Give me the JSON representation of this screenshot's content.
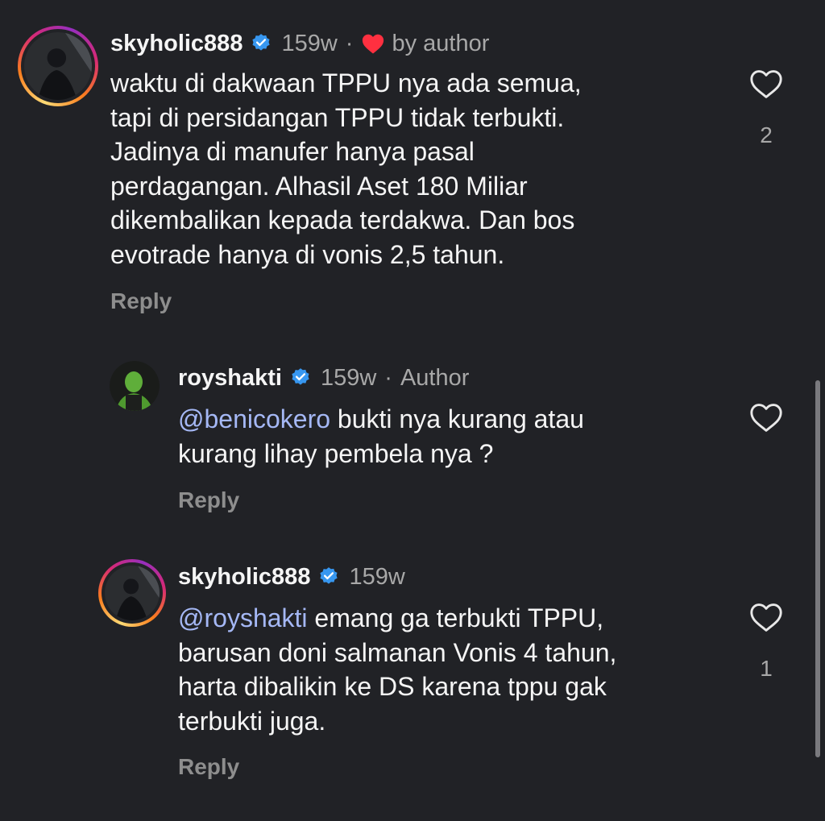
{
  "comments": [
    {
      "username": "skyholic888",
      "age": "159w",
      "separator": "·",
      "liked_label": "by author",
      "text_lines": [
        "waktu di dakwaan TPPU nya ada semua,",
        "tapi di persidangan TPPU tidak terbukti.",
        "Jadinya di manufer hanya pasal",
        "perdagangan. Alhasil Aset 180 Miliar",
        "dikembalikan kepada terdakwa. Dan bos",
        "evotrade hanya di vonis 2,5 tahun."
      ],
      "reply_label": "Reply",
      "like_count": "2"
    },
    {
      "username": "royshakti",
      "age": "159w",
      "separator": "·",
      "author_label": "Author",
      "mention": "@benicokero",
      "text_line1_rest": " bukti nya kurang atau",
      "text_line2": "kurang lihay  pembela  nya ?",
      "reply_label": "Reply"
    },
    {
      "username": "skyholic888",
      "age": "159w",
      "mention": "@royshakti",
      "text_line1_rest": " emang ga terbukti TPPU,",
      "text_line2": "barusan doni salmanan Vonis 4 tahun,",
      "text_line3": "harta dibalikin ke DS karena tppu gak",
      "text_line4": "terbukti juga.",
      "reply_label": "Reply",
      "like_count": "1"
    }
  ],
  "colors": {
    "background": "#212226",
    "mention": "#a5b8f5",
    "verified": "#3797f0",
    "heart_red": "#ff3040"
  },
  "icons": [
    "verified-badge-icon",
    "heart-filled-icon",
    "heart-outline-icon"
  ]
}
